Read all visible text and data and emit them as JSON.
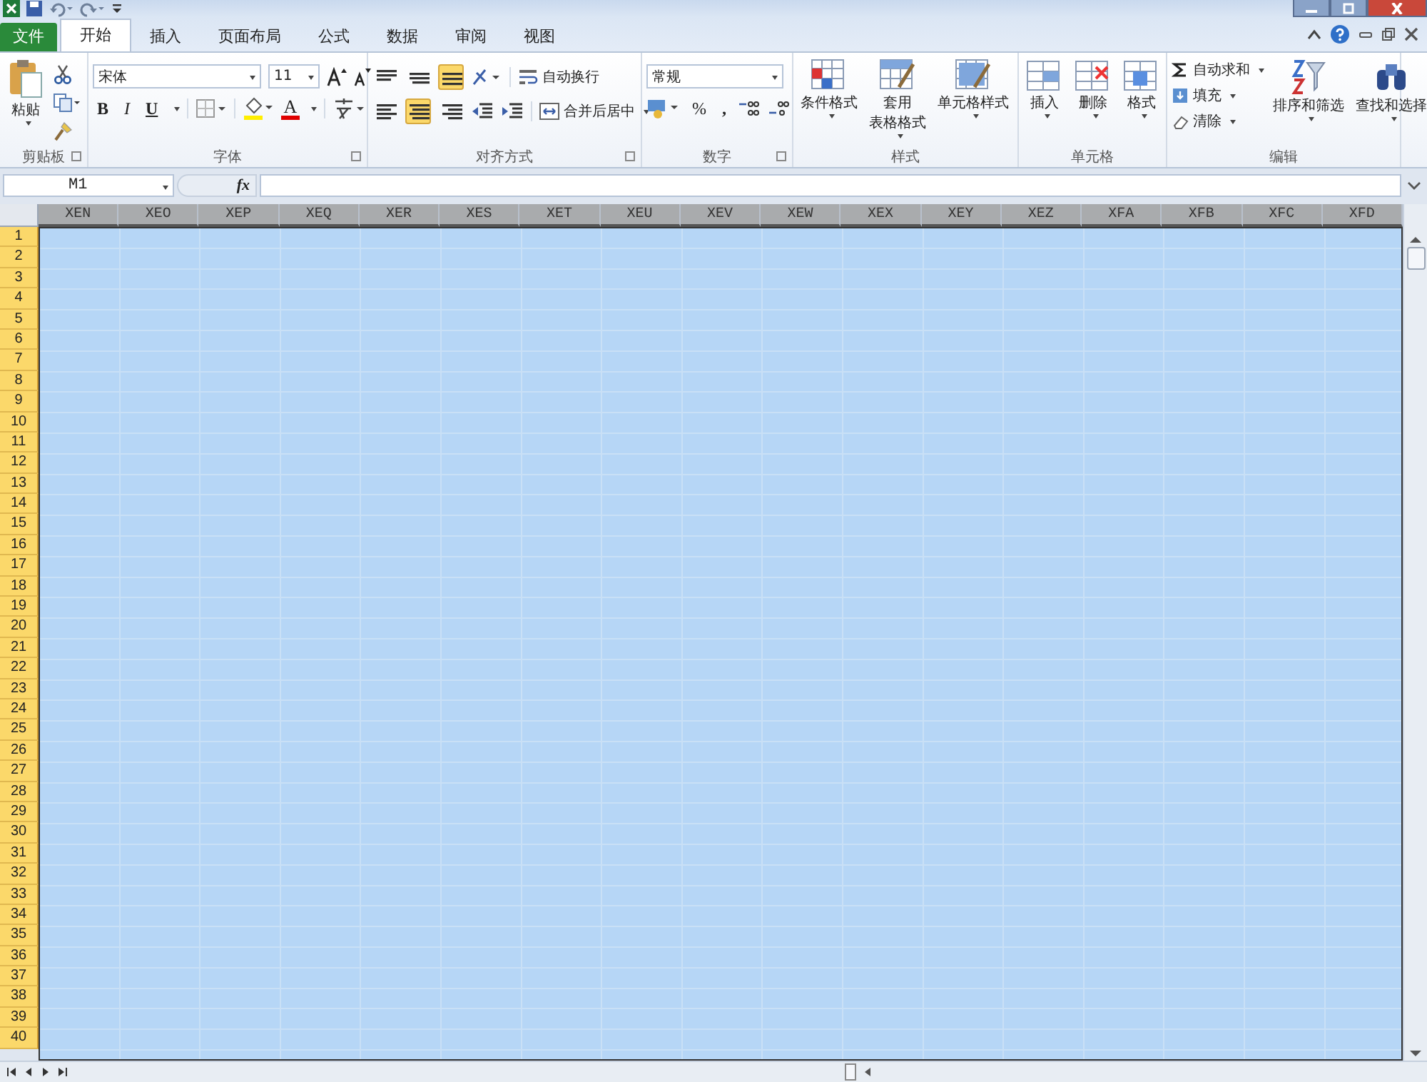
{
  "quick_access": [
    {
      "kind": "save"
    },
    {
      "kind": "undo"
    },
    {
      "kind": "redo"
    },
    {
      "kind": "customize"
    }
  ],
  "ribbon_tabs": [
    {
      "label": "文件",
      "kind": "file",
      "selected": false
    },
    {
      "label": "开始",
      "kind": "tab",
      "selected": true
    },
    {
      "label": "插入",
      "kind": "tab",
      "selected": false
    },
    {
      "label": "页面布局",
      "kind": "tab",
      "selected": false
    },
    {
      "label": "公式",
      "kind": "tab",
      "selected": false
    },
    {
      "label": "数据",
      "kind": "tab",
      "selected": false
    },
    {
      "label": "审阅",
      "kind": "tab",
      "selected": false
    },
    {
      "label": "视图",
      "kind": "tab",
      "selected": false
    }
  ],
  "clipboard": {
    "title": "剪贴板",
    "paste": "粘贴"
  },
  "font": {
    "title": "字体",
    "family": "宋体",
    "size": "11",
    "bold": "B",
    "italic": "I",
    "underline": "U",
    "font_color": "A"
  },
  "alignment": {
    "title": "对齐方式",
    "wrap": "自动换行",
    "merge": "合并后居中",
    "buttons": [
      {
        "kind": "top",
        "selected": false
      },
      {
        "kind": "middle",
        "selected": false
      },
      {
        "kind": "bottom",
        "selected": true
      },
      {
        "kind": "left",
        "selected": false
      },
      {
        "kind": "center",
        "selected": true
      },
      {
        "kind": "right",
        "selected": false
      }
    ]
  },
  "number": {
    "title": "数字",
    "format": "常规",
    "percent": "%",
    "comma": ","
  },
  "styles": {
    "title": "样式",
    "buttons": [
      {
        "kind": "conditional",
        "lines": [
          "条件格式"
        ]
      },
      {
        "kind": "table",
        "lines": [
          "套用",
          "表格格式"
        ]
      },
      {
        "kind": "cell",
        "lines": [
          "单元格样式"
        ]
      }
    ]
  },
  "cells": {
    "title": "单元格",
    "buttons": [
      {
        "kind": "insert",
        "label": "插入"
      },
      {
        "kind": "delete",
        "label": "删除"
      },
      {
        "kind": "format",
        "label": "格式"
      }
    ]
  },
  "editing": {
    "title": "编辑",
    "small": [
      {
        "kind": "sum",
        "label": "自动求和"
      },
      {
        "kind": "fill",
        "label": "填充"
      },
      {
        "kind": "clear",
        "label": "清除"
      }
    ],
    "big": [
      {
        "kind": "sort",
        "label": "排序和筛选"
      },
      {
        "kind": "find",
        "label": "查找和选择"
      }
    ]
  },
  "formula_bar": {
    "name_box": "M1",
    "fx": "fx"
  },
  "sheet": {
    "all_selected": true,
    "columns": [
      "XEN",
      "XEO",
      "XEP",
      "XEQ",
      "XER",
      "XES",
      "XET",
      "XEU",
      "XEV",
      "XEW",
      "XEX",
      "XEY",
      "XEZ",
      "XFA",
      "XFB",
      "XFC",
      "XFD"
    ],
    "rows": [
      "1",
      "2",
      "3",
      "4",
      "5",
      "6",
      "7",
      "8",
      "9",
      "10",
      "11",
      "12",
      "13",
      "14",
      "15",
      "16",
      "17",
      "18",
      "19",
      "20",
      "21",
      "22",
      "23",
      "24",
      "25",
      "26",
      "27",
      "28",
      "29",
      "30",
      "31",
      "32",
      "33",
      "34",
      "35",
      "36",
      "37",
      "38",
      "39",
      "40"
    ]
  }
}
